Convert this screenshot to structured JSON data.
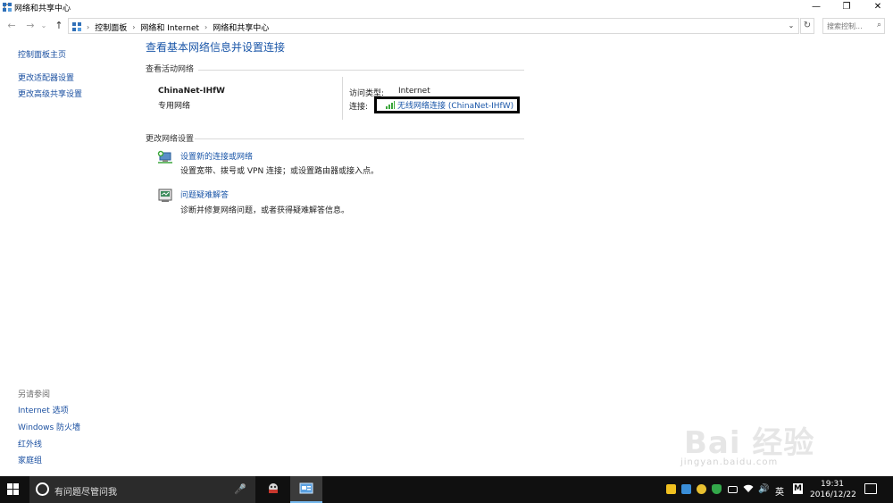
{
  "window": {
    "title": "网络和共享中心",
    "minimize_glyph": "—",
    "restore_glyph": "❐",
    "close_glyph": "✕"
  },
  "addressbar": {
    "back_glyph": "←",
    "forward_glyph": "→",
    "recent_glyph": "⌄",
    "up_glyph": "↑",
    "breadcrumbs": [
      "控制面板",
      "网络和 Internet",
      "网络和共享中心"
    ],
    "separator": "›",
    "dropdown_glyph": "⌄",
    "refresh_glyph": "↻",
    "search_placeholder": "搜索控制...",
    "search_icon_glyph": "⌕"
  },
  "sidebar": {
    "links": [
      "控制面板主页",
      "更改适配器设置",
      "更改高级共享设置"
    ],
    "see_also_heading": "另请参阅",
    "see_also": [
      "Internet 选项",
      "Windows 防火墙",
      "红外线",
      "家庭组"
    ]
  },
  "main": {
    "title": "查看基本网络信息并设置连接",
    "active_networks_heading": "查看活动网络",
    "network": {
      "name": "ChinaNet-IHfW",
      "category": "专用网络",
      "access_type_label": "访问类型:",
      "access_type_value": "Internet",
      "connections_label": "连接:",
      "connection_link": "无线网络连接 (ChinaNet-IHfW)"
    },
    "change_settings_heading": "更改网络设置",
    "tasks": [
      {
        "link": "设置新的连接或网络",
        "desc": "设置宽带、拨号或 VPN 连接；或设置路由器或接入点。"
      },
      {
        "link": "问题疑难解答",
        "desc": "诊断并修复网络问题，或者获得疑难解答信息。"
      }
    ]
  },
  "taskbar": {
    "search_placeholder": "有问题尽管问我",
    "mic_glyph": "🎤",
    "ime": "英",
    "ime_mode": "M",
    "volume_glyph": "🔊",
    "time": "19:31",
    "date": "2016/12/22"
  },
  "watermark": {
    "logo": "Bai 经验",
    "url": "jingyan.baidu.com"
  },
  "colors": {
    "link": "#1a56a8",
    "taskbar": "#101010",
    "active_app": "#3b3b3b"
  }
}
